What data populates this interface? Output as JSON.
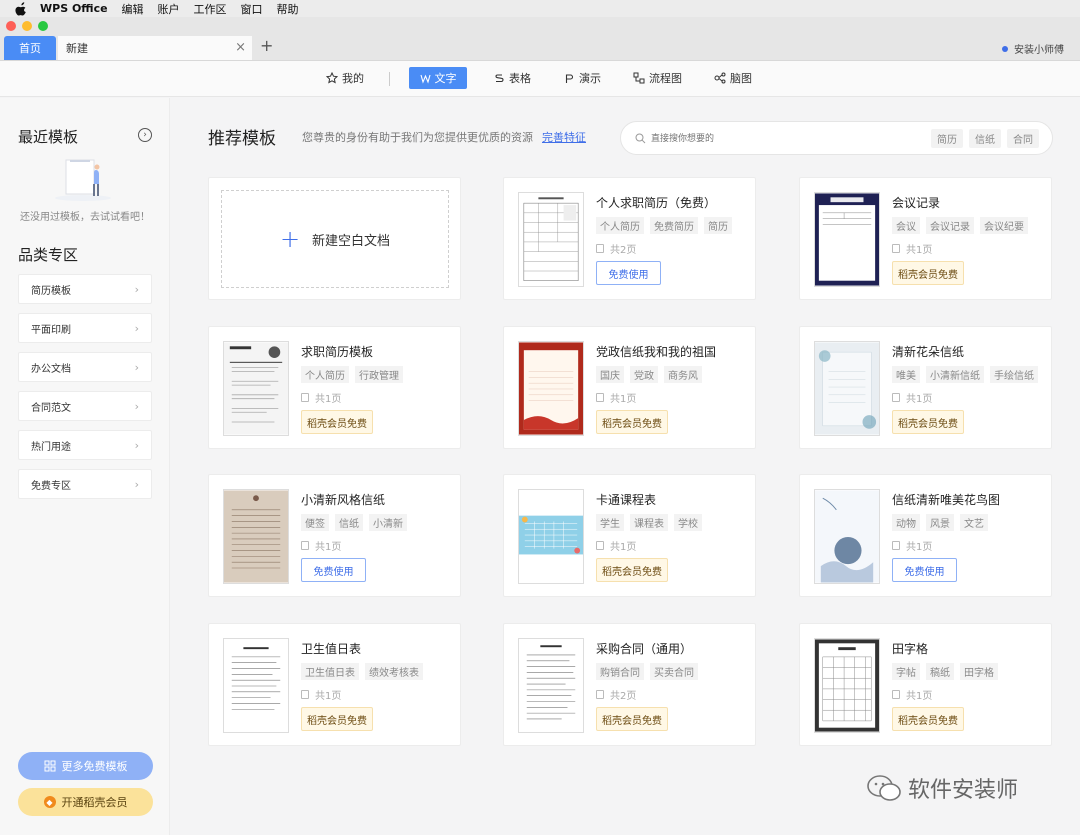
{
  "menubar": {
    "app": "WPS Office",
    "items": [
      "编辑",
      "账户",
      "工作区",
      "窗口",
      "帮助"
    ]
  },
  "tabs": {
    "home": "首页",
    "new": "新建"
  },
  "user": "安装小师傅",
  "toolbar": {
    "items": [
      {
        "label": "我的",
        "icon": "star-icon"
      },
      {
        "label": "文字",
        "icon": "w-doc-icon",
        "active": true
      },
      {
        "label": "表格",
        "icon": "s-sheet-icon"
      },
      {
        "label": "演示",
        "icon": "p-slide-icon"
      },
      {
        "label": "流程图",
        "icon": "flowchart-icon"
      },
      {
        "label": "脑图",
        "icon": "mindmap-icon"
      }
    ]
  },
  "sidebar": {
    "recent_title": "最近模板",
    "empty_text": "还没用过模板，去试试看吧！",
    "category_title": "品类专区",
    "categories": [
      "简历模板",
      "平面印刷",
      "办公文档",
      "合同范文",
      "热门用途",
      "免费专区"
    ],
    "more_button": "更多免费模板",
    "vip_button": "开通稻壳会员"
  },
  "main": {
    "title": "推荐模板",
    "subtitle": "您尊贵的身份有助于我们为您提供更优质的资源",
    "link": "完善特征",
    "search": {
      "placeholder": "直接搜你想要的",
      "tags": [
        "简历",
        "信纸",
        "合同"
      ]
    },
    "blank_label": "新建空白文档",
    "cards": [
      {
        "title": "个人求职简历（免费）",
        "tags": [
          "个人简历",
          "免费简历",
          "简历"
        ],
        "pages": "共2页",
        "action": "免费使用",
        "free": true
      },
      {
        "title": "会议记录",
        "tags": [
          "会议",
          "会议记录",
          "会议纪要"
        ],
        "pages": "共1页",
        "action": "稻壳会员免费",
        "free": false
      },
      {
        "title": "求职简历模板",
        "tags": [
          "个人简历",
          "行政管理"
        ],
        "pages": "共1页",
        "action": "稻壳会员免费",
        "free": false
      },
      {
        "title": "党政信纸我和我的祖国",
        "tags": [
          "国庆",
          "党政",
          "商务风"
        ],
        "pages": "共1页",
        "action": "稻壳会员免费",
        "free": false
      },
      {
        "title": "清新花朵信纸",
        "tags": [
          "唯美",
          "小清新信纸",
          "手绘信纸"
        ],
        "pages": "共1页",
        "action": "稻壳会员免费",
        "free": false
      },
      {
        "title": "小清新风格信纸",
        "tags": [
          "便签",
          "信纸",
          "小清新"
        ],
        "pages": "共1页",
        "action": "免费使用",
        "free": true
      },
      {
        "title": "卡通课程表",
        "tags": [
          "学生",
          "课程表",
          "学校"
        ],
        "pages": "共1页",
        "action": "稻壳会员免费",
        "free": false
      },
      {
        "title": "信纸清新唯美花鸟图",
        "tags": [
          "动物",
          "风景",
          "文艺"
        ],
        "pages": "共1页",
        "action": "免费使用",
        "free": true
      },
      {
        "title": "卫生值日表",
        "tags": [
          "卫生值日表",
          "绩效考核表"
        ],
        "pages": "共1页",
        "action": "稻壳会员免费",
        "free": false
      },
      {
        "title": "采购合同（通用）",
        "tags": [
          "购销合同",
          "买卖合同"
        ],
        "pages": "共2页",
        "action": "稻壳会员免费",
        "free": false
      },
      {
        "title": "田字格",
        "tags": [
          "字帖",
          "稿纸",
          "田字格"
        ],
        "pages": "共1页",
        "action": "稻壳会员免费",
        "free": false
      }
    ]
  },
  "watermark": "软件安装师",
  "colors": {
    "accent": "#4a8cf5",
    "link": "#3f6ee8",
    "vip_bg": "#fbe29a"
  }
}
